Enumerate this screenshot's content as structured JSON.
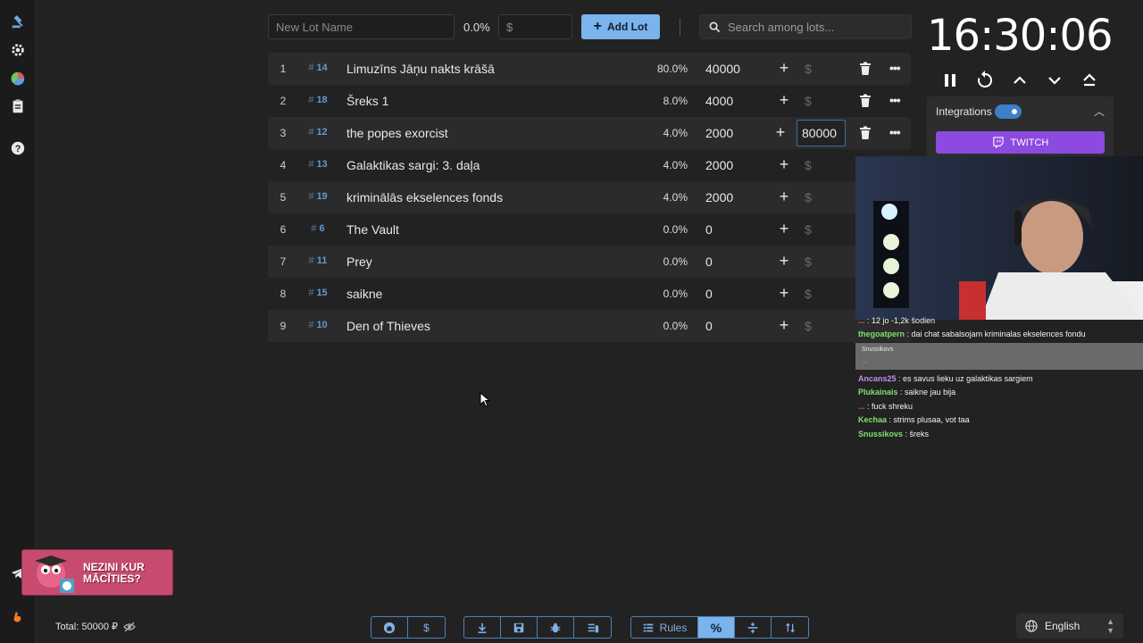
{
  "topbar": {
    "new_lot_placeholder": "New Lot Name",
    "percent": "0.0%",
    "amount_placeholder": "$",
    "add_lot_label": "Add Lot",
    "search_placeholder": "Search among lots..."
  },
  "lots": [
    {
      "num": "1",
      "id": "14",
      "name": "Limuzīns Jāņu nakts krāšā",
      "percent": "80.0%",
      "amount": "40000",
      "dollar": "$"
    },
    {
      "num": "2",
      "id": "18",
      "name": "Šreks 1",
      "percent": "8.0%",
      "amount": "4000",
      "dollar": "$"
    },
    {
      "num": "3",
      "id": "12",
      "name": "the popes exorcist",
      "percent": "4.0%",
      "amount": "2000",
      "edit_value": "80000"
    },
    {
      "num": "4",
      "id": "13",
      "name": "Galaktikas sargi: 3. daļa",
      "percent": "4.0%",
      "amount": "2000",
      "dollar": "$"
    },
    {
      "num": "5",
      "id": "19",
      "name": "kriminālās ekselences fonds",
      "percent": "4.0%",
      "amount": "2000",
      "dollar": "$"
    },
    {
      "num": "6",
      "id": "6",
      "name": "The Vault",
      "percent": "0.0%",
      "amount": "0",
      "dollar": "$"
    },
    {
      "num": "7",
      "id": "11",
      "name": "Prey",
      "percent": "0.0%",
      "amount": "0",
      "dollar": "$"
    },
    {
      "num": "8",
      "id": "15",
      "name": "saikne",
      "percent": "0.0%",
      "amount": "0",
      "dollar": "$"
    },
    {
      "num": "9",
      "id": "10",
      "name": "Den of Thieves",
      "percent": "0.0%",
      "amount": "0",
      "dollar": "$"
    }
  ],
  "timer": "16:30:06",
  "integrations": {
    "label": "Integrations",
    "enabled": true,
    "twitch_label": "TWITCH"
  },
  "chat": [
    {
      "user": "...",
      "text": ": 12 jo -1,2k šodien",
      "color": "#e0566e"
    },
    {
      "user": "thegoatpern",
      "text": ": dai chat sabalsojam kriminalas ekselences fondu",
      "color": "#7ee06e"
    },
    {
      "user": "Ancans25",
      "text": ": es savus lieku uz galaktikas sargiem",
      "color": "#c58fe8"
    },
    {
      "user": "Plukainais",
      "text": ": saikne jau bija",
      "color": "#7ee06e"
    },
    {
      "user": "...",
      "text": ": fuck shreku",
      "color": "#e0566e"
    },
    {
      "user": "Kechaa",
      "text": ": strims plusaa, vot taa",
      "color": "#7ee06e"
    },
    {
      "user": "Snussikovs",
      "text": ": šreks",
      "color": "#7ee06e"
    }
  ],
  "chat_highlight": {
    "user": "Snussikovs",
    "sub": "..."
  },
  "banner": {
    "text": "NEZINI KUR MĀCĪTIES?"
  },
  "footer": {
    "total": "Total: 50000 ₽",
    "rules_label": "Rules",
    "language": "English"
  },
  "colors": {
    "accent": "#7bb3ec",
    "twitch": "#8c4ae0",
    "id_blue": "#5b9bd5"
  }
}
